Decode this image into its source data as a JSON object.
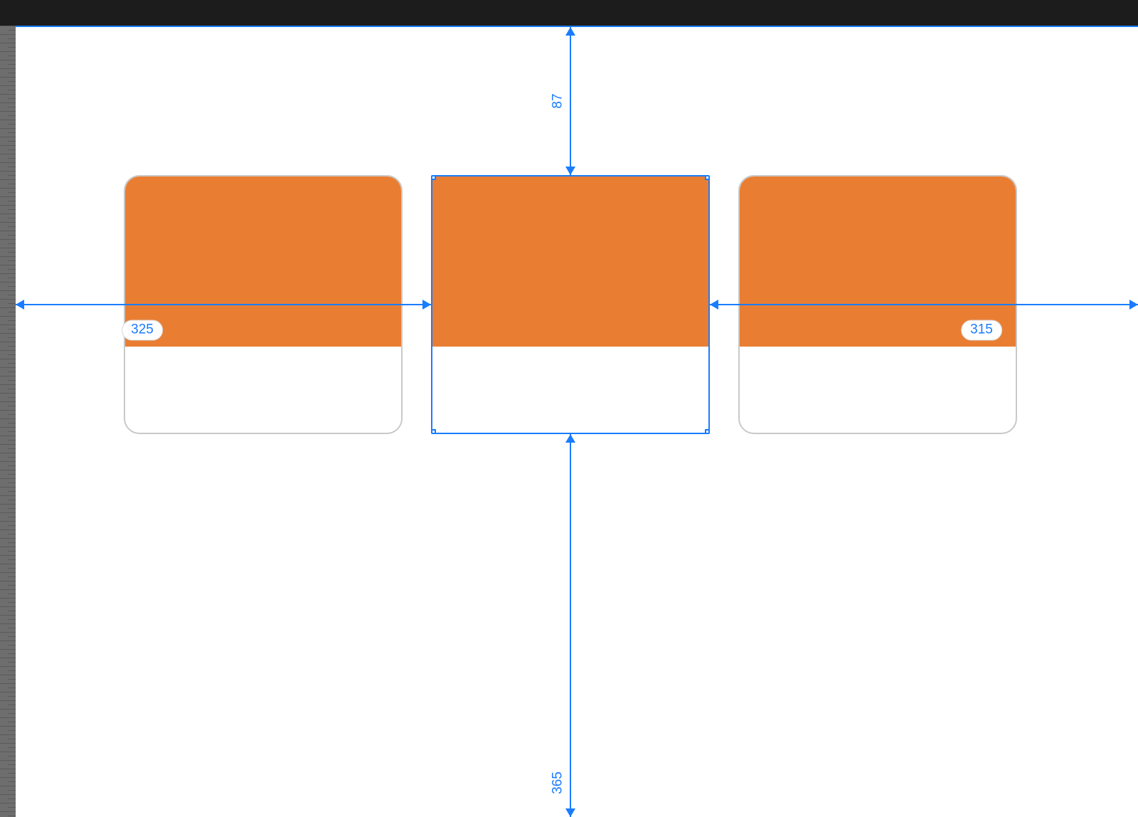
{
  "colors": {
    "selection": "#1a7cff",
    "card_fill": "#E97E33",
    "card_border": "#c9c9c9",
    "top_bar": "#1c1c1c",
    "ruler": "#6e6e6e"
  },
  "measurements": {
    "top": "87",
    "left": "325",
    "right": "315",
    "bottom": "365"
  },
  "cards": {
    "count": 3,
    "selected_index": 1
  }
}
